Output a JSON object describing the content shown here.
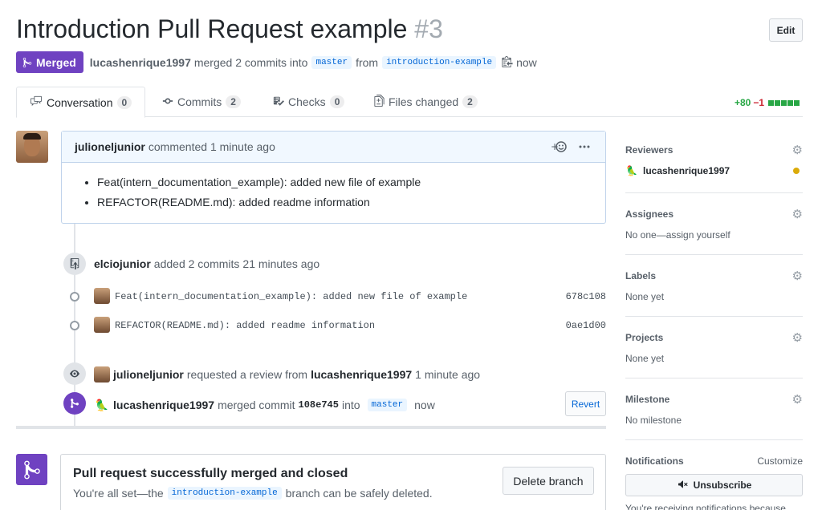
{
  "header": {
    "title": "Introduction Pull Request example",
    "number": "#3",
    "edit_label": "Edit"
  },
  "meta": {
    "state": "Merged",
    "author": "lucashenrique1997",
    "action": "merged 2 commits into",
    "base_branch": "master",
    "from_label": "from",
    "head_branch": "introduction-example",
    "time": "now"
  },
  "tabs": [
    {
      "label": "Conversation",
      "count": "0",
      "icon": "comment-discussion-icon"
    },
    {
      "label": "Commits",
      "count": "2",
      "icon": "git-commit-icon"
    },
    {
      "label": "Checks",
      "count": "0",
      "icon": "checklist-icon"
    },
    {
      "label": "Files changed",
      "count": "2",
      "icon": "file-diff-icon"
    }
  ],
  "diffstat": {
    "additions": "+80",
    "deletions": "−1",
    "colors": [
      "#28a745",
      "#28a745",
      "#28a745",
      "#28a745",
      "#28a745"
    ]
  },
  "comment": {
    "author": "julioneljunior",
    "action": "commented",
    "time": "1 minute ago",
    "items": [
      "Feat(intern_documentation_example): added new file of example",
      "REFACTOR(README.md): added readme information"
    ]
  },
  "timeline": {
    "commits_event": {
      "author": "elciojunior",
      "text": "added 2 commits",
      "time": "21 minutes ago"
    },
    "commits": [
      {
        "message": "Feat(intern_documentation_example): added new file of example",
        "sha": "678c108"
      },
      {
        "message": "REFACTOR(README.md): added readme information",
        "sha": "0ae1d00"
      }
    ],
    "review_event": {
      "author": "julioneljunior",
      "text": "requested a review from",
      "reviewer": "lucashenrique1997",
      "time": "1 minute ago"
    },
    "merge_event": {
      "author": "lucashenrique1997",
      "text": "merged commit",
      "sha": "108e745",
      "into": "into",
      "branch": "master",
      "time": "now",
      "revert_label": "Revert"
    }
  },
  "merge_box": {
    "title": "Pull request successfully merged and closed",
    "desc_before": "You're all set—the",
    "branch": "introduction-example",
    "desc_after": "branch can be safely deleted.",
    "delete_label": "Delete branch"
  },
  "sidebar": {
    "reviewers": {
      "heading": "Reviewers",
      "name": "lucashenrique1997"
    },
    "assignees": {
      "heading": "Assignees",
      "value": "No one—assign yourself"
    },
    "labels": {
      "heading": "Labels",
      "value": "None yet"
    },
    "projects": {
      "heading": "Projects",
      "value": "None yet"
    },
    "milestone": {
      "heading": "Milestone",
      "value": "No milestone"
    },
    "notifications": {
      "heading": "Notifications",
      "customize": "Customize",
      "unsubscribe": "Unsubscribe",
      "note": "You're receiving notifications because"
    }
  },
  "colors": {
    "merged": "#6f42c1",
    "link": "#0366d6",
    "pending": "#dbab09"
  }
}
